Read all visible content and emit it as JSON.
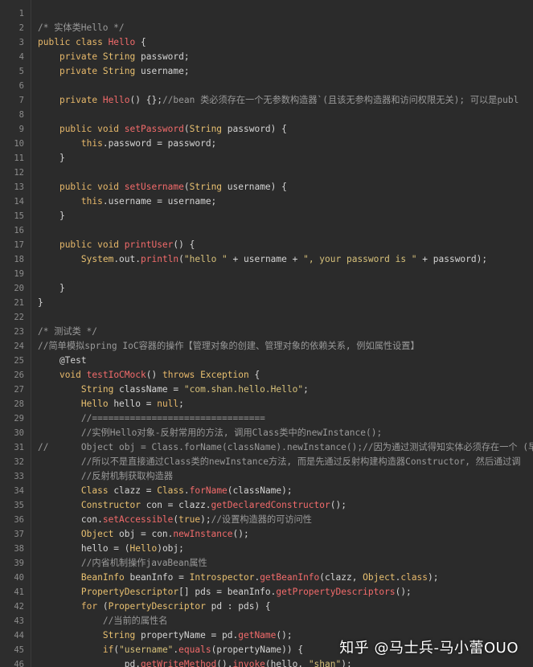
{
  "lines": [
    {
      "n": "1",
      "t": []
    },
    {
      "n": "2",
      "t": [
        {
          "c": "c",
          "v": "/* 实体类Hello */"
        }
      ]
    },
    {
      "n": "3",
      "t": [
        {
          "c": "k",
          "v": "public class "
        },
        {
          "c": "f",
          "v": "Hello"
        },
        {
          "c": "p",
          "v": " {"
        }
      ]
    },
    {
      "n": "4",
      "t": [
        {
          "c": "p",
          "v": "    "
        },
        {
          "c": "k",
          "v": "private "
        },
        {
          "c": "t",
          "v": "String"
        },
        {
          "c": "p",
          "v": " password;"
        }
      ]
    },
    {
      "n": "5",
      "t": [
        {
          "c": "p",
          "v": "    "
        },
        {
          "c": "k",
          "v": "private "
        },
        {
          "c": "t",
          "v": "String"
        },
        {
          "c": "p",
          "v": " username;"
        }
      ]
    },
    {
      "n": "6",
      "t": []
    },
    {
      "n": "7",
      "t": [
        {
          "c": "p",
          "v": "    "
        },
        {
          "c": "k",
          "v": "private "
        },
        {
          "c": "f",
          "v": "Hello"
        },
        {
          "c": "p",
          "v": "() {};"
        },
        {
          "c": "c",
          "v": "//bean 类必须存在一个无参数构造器`(且该无参构造器和访问权限无关); 可以是publ"
        }
      ]
    },
    {
      "n": "8",
      "t": []
    },
    {
      "n": "9",
      "t": [
        {
          "c": "p",
          "v": "    "
        },
        {
          "c": "k",
          "v": "public void "
        },
        {
          "c": "f",
          "v": "setPassword"
        },
        {
          "c": "p",
          "v": "("
        },
        {
          "c": "t",
          "v": "String"
        },
        {
          "c": "p",
          "v": " password) {"
        }
      ]
    },
    {
      "n": "10",
      "t": [
        {
          "c": "p",
          "v": "        "
        },
        {
          "c": "k",
          "v": "this"
        },
        {
          "c": "p",
          "v": ".password = password;"
        }
      ]
    },
    {
      "n": "11",
      "t": [
        {
          "c": "p",
          "v": "    }"
        }
      ]
    },
    {
      "n": "12",
      "t": []
    },
    {
      "n": "13",
      "t": [
        {
          "c": "p",
          "v": "    "
        },
        {
          "c": "k",
          "v": "public void "
        },
        {
          "c": "f",
          "v": "setUsername"
        },
        {
          "c": "p",
          "v": "("
        },
        {
          "c": "t",
          "v": "String"
        },
        {
          "c": "p",
          "v": " username) {"
        }
      ]
    },
    {
      "n": "14",
      "t": [
        {
          "c": "p",
          "v": "        "
        },
        {
          "c": "k",
          "v": "this"
        },
        {
          "c": "p",
          "v": ".username = username;"
        }
      ]
    },
    {
      "n": "15",
      "t": [
        {
          "c": "p",
          "v": "    }"
        }
      ]
    },
    {
      "n": "16",
      "t": []
    },
    {
      "n": "17",
      "t": [
        {
          "c": "p",
          "v": "    "
        },
        {
          "c": "k",
          "v": "public void "
        },
        {
          "c": "f",
          "v": "printUser"
        },
        {
          "c": "p",
          "v": "() {"
        }
      ]
    },
    {
      "n": "18",
      "t": [
        {
          "c": "p",
          "v": "        "
        },
        {
          "c": "t",
          "v": "System"
        },
        {
          "c": "p",
          "v": ".out."
        },
        {
          "c": "f",
          "v": "println"
        },
        {
          "c": "p",
          "v": "("
        },
        {
          "c": "s",
          "v": "\"hello \""
        },
        {
          "c": "p",
          "v": " + username + "
        },
        {
          "c": "s",
          "v": "\", your password is \""
        },
        {
          "c": "p",
          "v": " + password);"
        }
      ]
    },
    {
      "n": "19",
      "t": []
    },
    {
      "n": "20",
      "t": [
        {
          "c": "p",
          "v": "    }"
        }
      ]
    },
    {
      "n": "21",
      "t": [
        {
          "c": "p",
          "v": "}"
        }
      ]
    },
    {
      "n": "22",
      "t": []
    },
    {
      "n": "23",
      "t": [
        {
          "c": "c",
          "v": "/* 测试类 */"
        }
      ]
    },
    {
      "n": "24",
      "t": [
        {
          "c": "c",
          "v": "//简单模拟spring IoC容器的操作【管理对象的创建、管理对象的依赖关系, 例如属性设置】"
        }
      ]
    },
    {
      "n": "25",
      "t": [
        {
          "c": "p",
          "v": "    @Test"
        }
      ]
    },
    {
      "n": "26",
      "t": [
        {
          "c": "p",
          "v": "    "
        },
        {
          "c": "k",
          "v": "void "
        },
        {
          "c": "f",
          "v": "testIoCMock"
        },
        {
          "c": "p",
          "v": "() "
        },
        {
          "c": "k",
          "v": "throws "
        },
        {
          "c": "t",
          "v": "Exception"
        },
        {
          "c": "p",
          "v": " {"
        }
      ]
    },
    {
      "n": "27",
      "t": [
        {
          "c": "p",
          "v": "        "
        },
        {
          "c": "t",
          "v": "String"
        },
        {
          "c": "p",
          "v": " className = "
        },
        {
          "c": "s",
          "v": "\"com.shan.hello.Hello\""
        },
        {
          "c": "p",
          "v": ";"
        }
      ]
    },
    {
      "n": "28",
      "t": [
        {
          "c": "p",
          "v": "        "
        },
        {
          "c": "t",
          "v": "Hello"
        },
        {
          "c": "p",
          "v": " hello = "
        },
        {
          "c": "k",
          "v": "null"
        },
        {
          "c": "p",
          "v": ";"
        }
      ]
    },
    {
      "n": "29",
      "t": [
        {
          "c": "p",
          "v": "        "
        },
        {
          "c": "c",
          "v": "//================================"
        }
      ]
    },
    {
      "n": "30",
      "t": [
        {
          "c": "p",
          "v": "        "
        },
        {
          "c": "c",
          "v": "//实例Hello对象-反射常用的方法, 调用Class类中的newInstance();"
        }
      ]
    },
    {
      "n": "31",
      "t": [
        {
          "c": "c",
          "v": "//      Object obj = Class.forName(className).newInstance();//因为通过测试得知实体必须存在一个 (早"
        }
      ]
    },
    {
      "n": "32",
      "t": [
        {
          "c": "p",
          "v": "        "
        },
        {
          "c": "c",
          "v": "//所以不是直接通过Class类的newInstance方法, 而是先通过反射构建构造器Constructor, 然后通过调"
        }
      ]
    },
    {
      "n": "33",
      "t": [
        {
          "c": "p",
          "v": "        "
        },
        {
          "c": "c",
          "v": "//反射机制获取构造器"
        }
      ]
    },
    {
      "n": "34",
      "t": [
        {
          "c": "p",
          "v": "        "
        },
        {
          "c": "t",
          "v": "Class"
        },
        {
          "c": "p",
          "v": " clazz = "
        },
        {
          "c": "t",
          "v": "Class"
        },
        {
          "c": "p",
          "v": "."
        },
        {
          "c": "f",
          "v": "forName"
        },
        {
          "c": "p",
          "v": "(className);"
        }
      ]
    },
    {
      "n": "35",
      "t": [
        {
          "c": "p",
          "v": "        "
        },
        {
          "c": "t",
          "v": "Constructor"
        },
        {
          "c": "p",
          "v": " con = clazz."
        },
        {
          "c": "f",
          "v": "getDeclaredConstructor"
        },
        {
          "c": "p",
          "v": "();"
        }
      ]
    },
    {
      "n": "36",
      "t": [
        {
          "c": "p",
          "v": "        con."
        },
        {
          "c": "f",
          "v": "setAccessible"
        },
        {
          "c": "p",
          "v": "("
        },
        {
          "c": "k",
          "v": "true"
        },
        {
          "c": "p",
          "v": ");"
        },
        {
          "c": "c",
          "v": "//设置构造器的可访问性"
        }
      ]
    },
    {
      "n": "37",
      "t": [
        {
          "c": "p",
          "v": "        "
        },
        {
          "c": "t",
          "v": "Object"
        },
        {
          "c": "p",
          "v": " obj = con."
        },
        {
          "c": "f",
          "v": "newInstance"
        },
        {
          "c": "p",
          "v": "();"
        }
      ]
    },
    {
      "n": "38",
      "t": [
        {
          "c": "p",
          "v": "        hello = ("
        },
        {
          "c": "t",
          "v": "Hello"
        },
        {
          "c": "p",
          "v": ")obj;"
        }
      ]
    },
    {
      "n": "39",
      "t": [
        {
          "c": "p",
          "v": "        "
        },
        {
          "c": "c",
          "v": "//内省机制操作javaBean属性"
        }
      ]
    },
    {
      "n": "40",
      "t": [
        {
          "c": "p",
          "v": "        "
        },
        {
          "c": "t",
          "v": "BeanInfo"
        },
        {
          "c": "p",
          "v": " beanInfo = "
        },
        {
          "c": "t",
          "v": "Introspector"
        },
        {
          "c": "p",
          "v": "."
        },
        {
          "c": "f",
          "v": "getBeanInfo"
        },
        {
          "c": "p",
          "v": "(clazz, "
        },
        {
          "c": "t",
          "v": "Object"
        },
        {
          "c": "p",
          "v": "."
        },
        {
          "c": "k",
          "v": "class"
        },
        {
          "c": "p",
          "v": ");"
        }
      ]
    },
    {
      "n": "41",
      "t": [
        {
          "c": "p",
          "v": "        "
        },
        {
          "c": "t",
          "v": "PropertyDescriptor"
        },
        {
          "c": "p",
          "v": "[] pds = beanInfo."
        },
        {
          "c": "f",
          "v": "getPropertyDescriptors"
        },
        {
          "c": "p",
          "v": "();"
        }
      ]
    },
    {
      "n": "42",
      "t": [
        {
          "c": "p",
          "v": "        "
        },
        {
          "c": "k",
          "v": "for "
        },
        {
          "c": "p",
          "v": "("
        },
        {
          "c": "t",
          "v": "PropertyDescriptor"
        },
        {
          "c": "p",
          "v": " pd : pds) {"
        }
      ]
    },
    {
      "n": "43",
      "t": [
        {
          "c": "p",
          "v": "            "
        },
        {
          "c": "c",
          "v": "//当前的属性名"
        }
      ]
    },
    {
      "n": "44",
      "t": [
        {
          "c": "p",
          "v": "            "
        },
        {
          "c": "t",
          "v": "String"
        },
        {
          "c": "p",
          "v": " propertyName = pd."
        },
        {
          "c": "f",
          "v": "getName"
        },
        {
          "c": "p",
          "v": "();"
        }
      ]
    },
    {
      "n": "45",
      "t": [
        {
          "c": "p",
          "v": "            "
        },
        {
          "c": "k",
          "v": "if"
        },
        {
          "c": "p",
          "v": "("
        },
        {
          "c": "s",
          "v": "\"username\""
        },
        {
          "c": "p",
          "v": "."
        },
        {
          "c": "f",
          "v": "equals"
        },
        {
          "c": "p",
          "v": "(propertyName)) {"
        }
      ]
    },
    {
      "n": "46",
      "t": [
        {
          "c": "p",
          "v": "                pd."
        },
        {
          "c": "f",
          "v": "getWriteMethod"
        },
        {
          "c": "p",
          "v": "()."
        },
        {
          "c": "f",
          "v": "invoke"
        },
        {
          "c": "p",
          "v": "(hello, "
        },
        {
          "c": "s",
          "v": "\"shan\""
        },
        {
          "c": "p",
          "v": ");"
        }
      ]
    }
  ],
  "watermark": "知乎 @马士兵-马小蕾OUO"
}
